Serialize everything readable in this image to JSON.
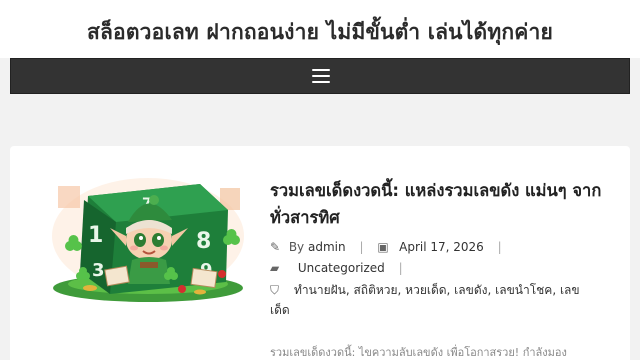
{
  "site": {
    "title": "สล็อตวอเลท ฝากถอนง่าย ไม่มีขั้นต่ำ เล่นได้ทุกค่าย"
  },
  "nav": {
    "menu_icon": "hamburger-menu-icon"
  },
  "post": {
    "title": "รวมเลขเด็ดงวดนี้: แหล่งรวมเลขดัง แม่นๆ จากทั่วสารทิศ",
    "by_label": "By",
    "author": "admin",
    "date": "April 17, 2026",
    "category": "Uncategorized",
    "tags": "ทำนายฝัน, สถิติหวย, หวยเด็ด, เลขดัง, เลขนำโชค, เลขเด็ด",
    "excerpt": "รวมเลขเด็ดงวดนี้: ไขความลับเลขดัง เพื่อโอกาสรวย! กำลังมอง",
    "icons": {
      "author": "pencil-icon",
      "date": "calendar-icon",
      "category": "folder-icon",
      "tags": "tags-icon"
    }
  },
  "colors": {
    "nav_bg": "#333333",
    "page_bg": "#f2f2f2",
    "card_bg": "#ffffff"
  }
}
